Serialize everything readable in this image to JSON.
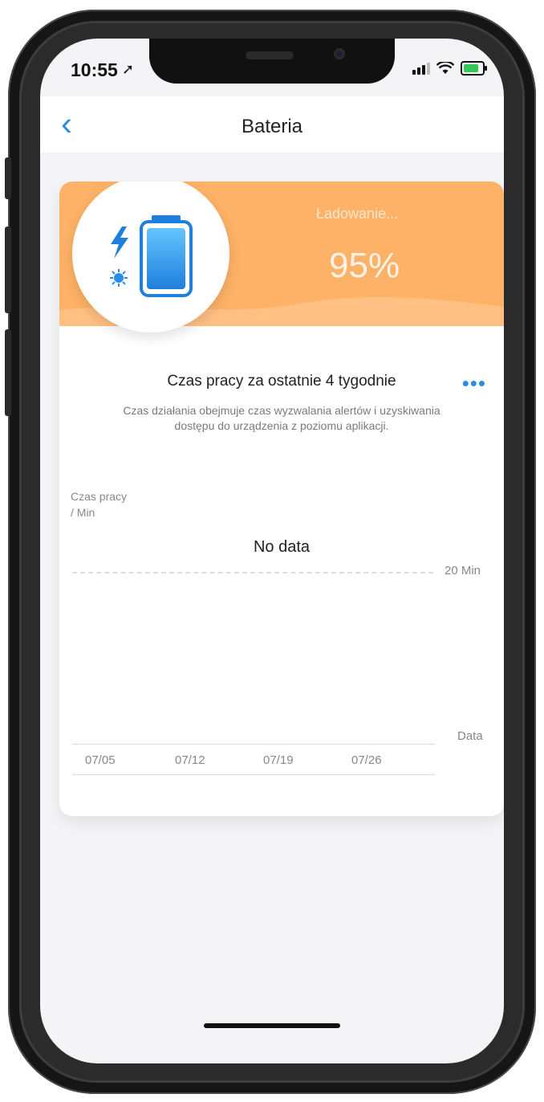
{
  "status_bar": {
    "time": "10:55",
    "location_icon": "location-arrow-icon",
    "signal_icon": "signal-icon",
    "wifi_icon": "wifi-icon",
    "battery_icon": "battery-charging-icon",
    "battery_color": "#36c759"
  },
  "navbar": {
    "back_icon": "chevron-left-icon",
    "title": "Bateria"
  },
  "battery_card": {
    "status_label": "Ładowanie...",
    "percent": "95%",
    "banner_color": "#fdb267",
    "icons": [
      "lightning-icon",
      "sun-icon",
      "battery-icon"
    ]
  },
  "usage_section": {
    "title": "Czas pracy za ostatnie 4 tygodnie",
    "more_icon": "more-dots-icon",
    "description": "Czas działania obejmuje czas wyzwalania alertów i uzyskiwania dostępu do urządzenia z poziomu aplikacji."
  },
  "chart_data": {
    "type": "bar",
    "ylabel": "Czas pracy\n/ Min",
    "xlabel": "Data",
    "empty_message": "No data",
    "gridline_label": "20 Min",
    "categories": [
      "07/05",
      "07/12",
      "07/19",
      "07/26"
    ],
    "values": []
  },
  "accent_color": "#2b8de2"
}
